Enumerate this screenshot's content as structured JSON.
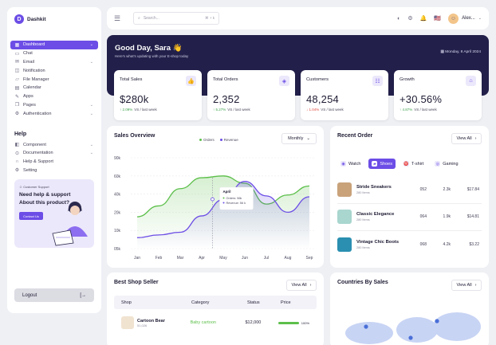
{
  "brand": {
    "name": "Dashkit"
  },
  "sidebar": {
    "items": [
      {
        "label": "Dashboard",
        "icon": "grid-icon",
        "chev": true,
        "active": true
      },
      {
        "label": "Chat",
        "icon": "chat-icon",
        "chev": false
      },
      {
        "label": "Email",
        "icon": "mail-icon",
        "chev": true
      },
      {
        "label": "Notification",
        "icon": "bell-icon",
        "chev": false
      },
      {
        "label": "File Manager",
        "icon": "folder-icon",
        "chev": false
      },
      {
        "label": "Calendar",
        "icon": "calendar-icon",
        "chev": false
      },
      {
        "label": "Apps",
        "icon": "apps-icon",
        "chev": false
      },
      {
        "label": "Pages",
        "icon": "pages-icon",
        "chev": true
      },
      {
        "label": "Authentication",
        "icon": "gear-icon",
        "chev": true
      }
    ],
    "help_title": "Help",
    "help_items": [
      {
        "label": "Component",
        "icon": "component-icon",
        "chev": true
      },
      {
        "label": "Documentation",
        "icon": "doc-icon",
        "chev": true
      },
      {
        "label": "Help & Support",
        "icon": "headset-icon",
        "chev": false
      },
      {
        "label": "Setting",
        "icon": "settings-icon",
        "chev": false
      }
    ],
    "support": {
      "tag": "Customer Support",
      "question": "Need help & support About this product?",
      "button": "Contact Us"
    },
    "logout": "Logout"
  },
  "topbar": {
    "search_placeholder": "Search...",
    "shortcut": "⌘ + k",
    "user_name": "Alex..."
  },
  "hero": {
    "greeting": "Good Day, Sara 👋",
    "subtitle": "Here's what's updating with your E-shop today",
    "date": "Monday, 8 April 2024"
  },
  "stats": [
    {
      "label": "Total Sales",
      "value": "$280k",
      "delta": "2.09%",
      "dir": "up",
      "suffix": "VS / last week",
      "icon": "thumbs-up-icon"
    },
    {
      "label": "Total Orders",
      "value": "2,352",
      "delta": "5.27%",
      "dir": "up",
      "suffix": "VS / last week",
      "icon": "box-icon"
    },
    {
      "label": "Customers",
      "value": "48,254",
      "delta": "1.04%",
      "dir": "down",
      "suffix": "VS / last week",
      "icon": "users-icon"
    },
    {
      "label": "Growth",
      "value": "+30.56%",
      "delta": "4.87%",
      "dir": "up",
      "suffix": "VS / last week",
      "icon": "growth-icon"
    }
  ],
  "sales_overview": {
    "title": "Sales Overview",
    "period": "Monthly",
    "legend": [
      "Orders",
      "Revenue"
    ]
  },
  "chart_data": {
    "type": "line",
    "title": "Sales Overview",
    "categories": [
      "Jan",
      "Feb",
      "Mar",
      "Apr",
      "May",
      "Jun",
      "Jul",
      "Aug",
      "Sep"
    ],
    "y_ticks": [
      "90k",
      "60k",
      "40k",
      "20k",
      "10k",
      "05k"
    ],
    "series": [
      {
        "name": "Orders",
        "color": "#5cbf4a",
        "values": [
          0.35,
          0.47,
          0.66,
          0.78,
          0.8,
          0.72,
          0.49,
          0.59,
          0.69
        ]
      },
      {
        "name": "Revenue",
        "color": "#6c4de6",
        "values": [
          0.12,
          0.15,
          0.18,
          0.36,
          0.54,
          0.74,
          0.58,
          0.4,
          0.57
        ]
      }
    ],
    "tooltip": {
      "month": "April",
      "lines": [
        "Orders: 56k",
        "Revenue: 56 k"
      ]
    },
    "grid": true,
    "legend_position": "top"
  },
  "recent_order": {
    "title": "Recent Order",
    "view_all": "View All",
    "tabs": [
      {
        "label": "Watch",
        "icon": "watch-icon",
        "active": false
      },
      {
        "label": "Shoes",
        "icon": "shoe-icon",
        "active": true
      },
      {
        "label": "T-shirt",
        "icon": "tshirt-icon",
        "active": false
      },
      {
        "label": "Gaming",
        "icon": "gamepad-icon",
        "active": false
      }
    ],
    "orders": [
      {
        "name": "Stride Sneakers",
        "items": "280 Items",
        "c1": "052",
        "c2": "2.3k",
        "c3": "$17.84",
        "color": "#c9a27a"
      },
      {
        "name": "Classic Elegance",
        "items": "280 Items",
        "c1": "064",
        "c2": "1.9k",
        "c3": "$14.81",
        "color": "#a9d6cf"
      },
      {
        "name": "Vintage Chic Boots",
        "items": "280 Items",
        "c1": "068",
        "c2": "4.2k",
        "c3": "$3.22",
        "color": "#2a8fb0"
      }
    ]
  },
  "best_seller": {
    "title": "Best Shop Seller",
    "view_all": "View All",
    "columns": [
      "Shop",
      "Category",
      "Status",
      "Price"
    ],
    "rows": [
      {
        "shop": "Cartoon Bear",
        "sub": "51,026",
        "category": "Baby cartoon",
        "status": "$12,000",
        "price": "100%",
        "progress": 1.0
      }
    ]
  },
  "countries": {
    "title": "Countries By Sales",
    "view_all": "View All"
  }
}
